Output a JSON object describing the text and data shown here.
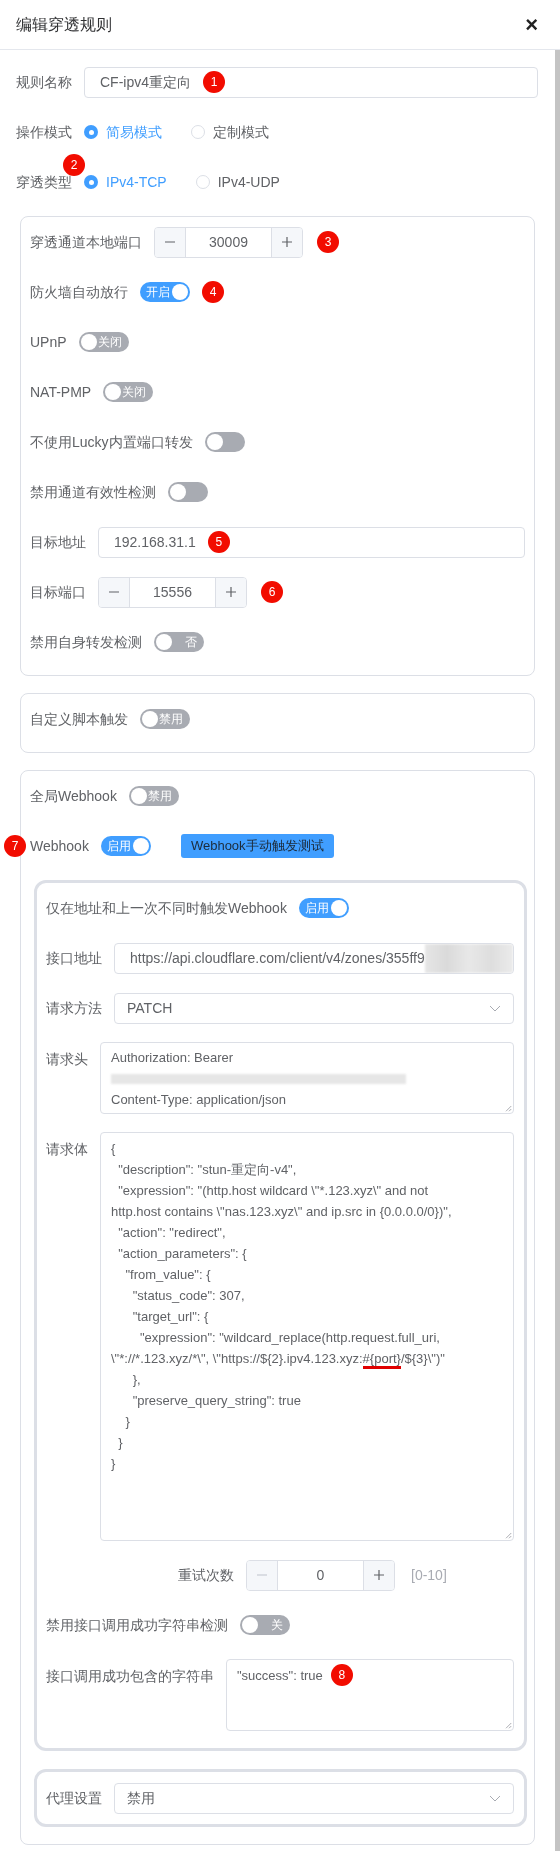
{
  "dialog": {
    "title": "编辑穿透规则",
    "close": "×"
  },
  "top_rows": [
    {
      "kind": "input",
      "label": "规则名称",
      "value": "CF-ipv4重定向",
      "marker": "1"
    },
    {
      "kind": "radio",
      "label": "操作模式",
      "options": [
        {
          "label": "简易模式",
          "selected": true
        },
        {
          "label": "定制模式",
          "selected": false
        }
      ]
    },
    {
      "kind": "radio",
      "label": "穿透类型",
      "marker": "2",
      "options": [
        {
          "label": "IPv4-TCP",
          "selected": true
        },
        {
          "label": "IPv4-UDP",
          "selected": false
        }
      ]
    }
  ],
  "cards": [
    {
      "rows": [
        {
          "kind": "stepper",
          "label": "穿透通道本地端口",
          "value": "30009",
          "marker": "3"
        },
        {
          "kind": "switch",
          "label": "防火墙自动放行",
          "on": true,
          "text": "开启",
          "marker": "4"
        },
        {
          "kind": "switch",
          "label": "UPnP",
          "on": false,
          "text": "关闭"
        },
        {
          "kind": "switch",
          "label": "NAT-PMP",
          "on": false,
          "text": "关闭"
        },
        {
          "kind": "switch",
          "label": "不使用Lucky内置端口转发",
          "on": false
        },
        {
          "kind": "switch",
          "label": "禁用通道有效性检测",
          "on": false
        },
        {
          "kind": "input",
          "label": "目标地址",
          "value": "192.168.31.1",
          "marker": "5"
        },
        {
          "kind": "stepper",
          "label": "目标端口",
          "value": "15556",
          "marker": "6"
        },
        {
          "kind": "switch",
          "label": "禁用自身转发检测",
          "on": false,
          "text": "否"
        }
      ]
    },
    {
      "rows": [
        {
          "kind": "switch",
          "label": "自定义脚本触发",
          "on": false,
          "text": "禁用"
        }
      ]
    },
    {
      "rows": [
        {
          "kind": "switch",
          "label": "全局Webhook",
          "on": false,
          "text": "禁用"
        },
        {
          "kind": "switch",
          "label": "Webhook",
          "on": true,
          "text": "启用",
          "marker": "7",
          "button": "Webhook手动触发测试"
        },
        {
          "kind": "subcard",
          "rows": [
            {
              "kind": "switch",
              "label": "仅在地址和上一次不同时触发Webhook",
              "on": true,
              "text": "启用"
            },
            {
              "kind": "input",
              "label": "接口地址",
              "value": "https://api.cloudflare.com/client/v4/zones/355ff9",
              "redacted": true
            },
            {
              "kind": "select",
              "label": "请求方法",
              "value": "PATCH"
            },
            {
              "kind": "textarea",
              "label": "请求头",
              "lines": [
                {
                  "kind": "text",
                  "text": "Authorization: Bearer"
                },
                {
                  "kind": "redacted"
                },
                {
                  "kind": "text",
                  "text": "Content-Type: application/json"
                }
              ]
            },
            {
              "kind": "long_textarea",
              "label": "请求体",
              "lines": [
                {
                  "kind": "text",
                  "text": "{"
                },
                {
                  "kind": "text",
                  "text": "  \"description\": \"stun-重定向-v4\","
                },
                {
                  "kind": "text",
                  "text": "  \"expression\": \"(http.host wildcard \\\"*.123.xyz\\\" and not"
                },
                {
                  "kind": "text",
                  "text": "http.host contains \\\"nas.123.xyz\\\" and ip.src in {0.0.0.0/0})\","
                },
                {
                  "kind": "text",
                  "text": "  \"action\": \"redirect\","
                },
                {
                  "kind": "text",
                  "text": "  \"action_parameters\": {"
                },
                {
                  "kind": "text",
                  "text": "    \"from_value\": {"
                },
                {
                  "kind": "text",
                  "text": "      \"status_code\": 307,"
                },
                {
                  "kind": "text",
                  "text": "      \"target_url\": {"
                },
                {
                  "kind": "text",
                  "text": "        \"expression\": \"wildcard_replace(http.request.full_uri,"
                },
                {
                  "kind": "parts",
                  "parts": [
                    {
                      "text": "\\\"*://*.123.xyz/*\\\", \\\"https://${2}.ipv4.123.xyz:",
                      "underlined": false
                    },
                    {
                      "text": "#{port}",
                      "underlined": true
                    },
                    {
                      "text": "/${3}\\\")\"",
                      "underlined": false
                    }
                  ]
                },
                {
                  "kind": "text",
                  "text": "      },"
                },
                {
                  "kind": "text",
                  "text": "      \"preserve_query_string\": true"
                },
                {
                  "kind": "text",
                  "text": "    }"
                },
                {
                  "kind": "text",
                  "text": "  }"
                },
                {
                  "kind": "text",
                  "text": "}"
                }
              ]
            },
            {
              "kind": "centered_stepper",
              "label": "重试次数",
              "value": "0",
              "hint": "[0-10]",
              "minus_disabled": true
            },
            {
              "kind": "switch",
              "label": "禁用接口调用成功字符串检测",
              "on": false,
              "text": "关"
            },
            {
              "kind": "textarea",
              "label": "接口调用成功包含的字符串",
              "marker": "8",
              "lines": [
                {
                  "kind": "text",
                  "text": "\"success\": true"
                }
              ]
            }
          ]
        },
        {
          "kind": "subcard",
          "rows": [
            {
              "kind": "select",
              "label": "代理设置",
              "value": "禁用"
            }
          ]
        }
      ]
    }
  ]
}
